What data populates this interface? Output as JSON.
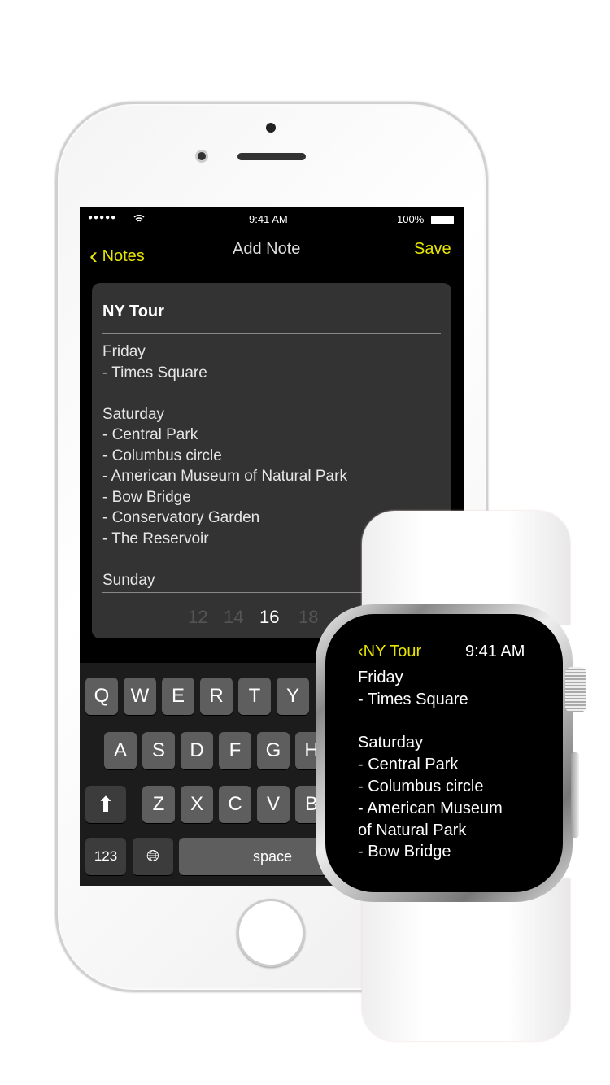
{
  "status": {
    "carrier_dots": "●●●●●",
    "time": "9:41 AM",
    "battery": "100%"
  },
  "nav": {
    "back_label": "Notes",
    "title": "Add Note",
    "save_label": "Save",
    "accent": "#E6E600"
  },
  "note": {
    "title": "NY Tour",
    "body": "Friday\n- Times Square\n\nSaturday\n- Central Park\n- Columbus circle\n- American Museum of Natural Park\n- Bow Bridge\n- Conservatory Garden\n- The Reservoir\n\nSunday"
  },
  "font_sizes": {
    "options": [
      "12",
      "14",
      "16",
      "18"
    ],
    "selected": "16"
  },
  "keyboard": {
    "row1": [
      "Q",
      "W",
      "E",
      "R",
      "T",
      "Y"
    ],
    "row2": [
      "A",
      "S",
      "D",
      "F",
      "G",
      "H"
    ],
    "row3": [
      "Z",
      "X",
      "C",
      "V",
      "B"
    ],
    "numbers": "123",
    "space": "space"
  },
  "watch": {
    "back_label": "NY Tour",
    "time": "9:41 AM",
    "lines": [
      "Friday",
      "- Times Square",
      "",
      "Saturday",
      "- Central Park",
      "- Columbus circle",
      "- American Museum",
      "of Natural Park",
      "- Bow Bridge"
    ]
  }
}
